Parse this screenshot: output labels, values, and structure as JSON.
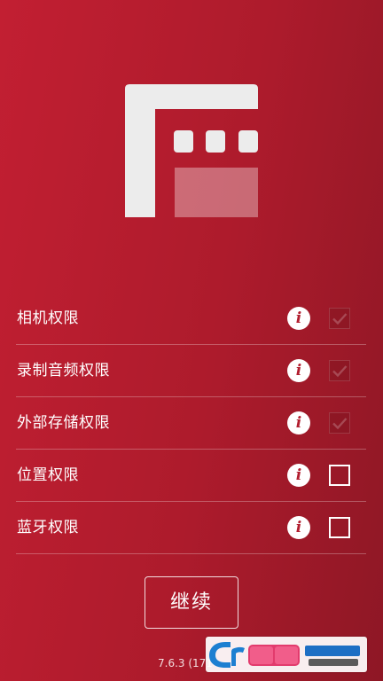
{
  "permissions": [
    {
      "label": "相机权限",
      "checked": true
    },
    {
      "label": "录制音频权限",
      "checked": true
    },
    {
      "label": "外部存储权限",
      "checked": true
    },
    {
      "label": "位置权限",
      "checked": false
    },
    {
      "label": "蓝牙权限",
      "checked": false
    }
  ],
  "info_glyph": "i",
  "continue_label": "继续",
  "version": "7.6.3 (171",
  "icons": {
    "logo": "filmic-clapper-logo",
    "info": "info-icon",
    "check": "checkmark-icon"
  },
  "colors": {
    "background_start": "#c21f32",
    "background_end": "#8e1725",
    "accent_white": "#ffffff"
  }
}
